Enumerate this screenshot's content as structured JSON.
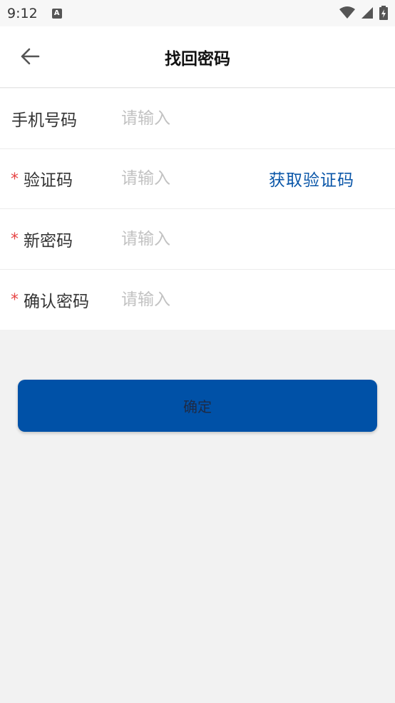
{
  "status_bar": {
    "time": "9:12",
    "notification_letter": "A"
  },
  "header": {
    "title": "找回密码"
  },
  "form": {
    "rows": [
      {
        "label": "手机号码",
        "required": false,
        "placeholder": "请输入"
      },
      {
        "label": "验证码",
        "required": true,
        "placeholder": "请输入",
        "action": "获取验证码"
      },
      {
        "label": "新密码",
        "required": true,
        "placeholder": "请输入"
      },
      {
        "label": "确认密码",
        "required": true,
        "placeholder": "请输入"
      }
    ],
    "required_mark": "*"
  },
  "confirm_button": {
    "label": "确定"
  },
  "colors": {
    "accent": "#0051a7",
    "link": "#0a56a8",
    "required": "#e64545",
    "background": "#f2f2f2"
  }
}
